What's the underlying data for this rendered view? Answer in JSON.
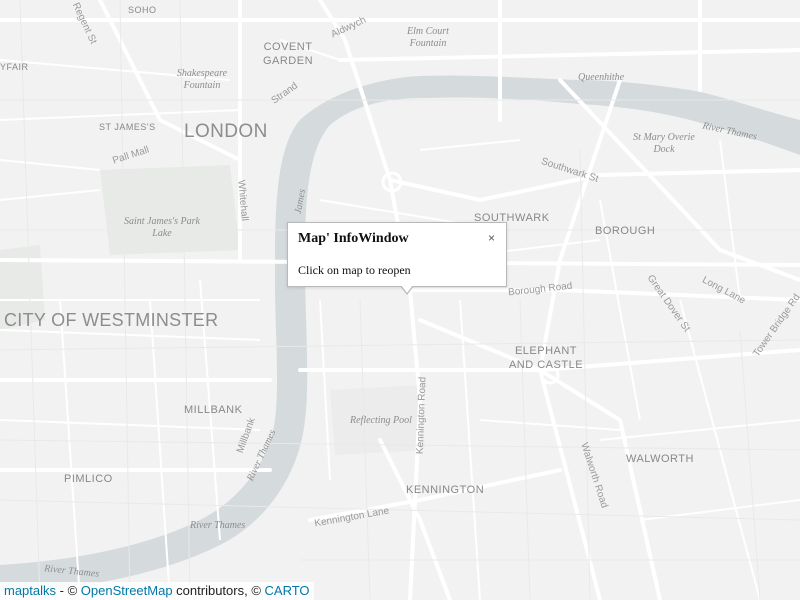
{
  "map": {
    "labels": {
      "soho": "SOHO",
      "covent_garden": "COVENT GARDEN",
      "elm_court": "Elm Court Fountain",
      "shakespeare": "Shakespeare Fountain",
      "queenhithe": "Queenhithe",
      "st_james": "ST JAMES'S",
      "london": "LONDON",
      "pall_mall": "Pall Mall",
      "whitehall": "Whitehall",
      "st_mary_overie": "St Mary Overie Dock",
      "river_thames_ne": "River Thames",
      "southwark_st": "Southwark St",
      "saint_james_park": "Saint James's Park Lake",
      "southwark": "SOUTHWARK",
      "borough": "BOROUGH",
      "borough_road": "Borough Road",
      "city_westminster": "CITY OF WESTMINSTER",
      "elephant_castle": "ELEPHANT AND CASTLE",
      "long_lane": "Long Lane",
      "great_dover": "Great Dover St",
      "tower_bridge": "Tower Bridge Rd",
      "millbank": "MILLBANK",
      "reflecting_pool": "Reflecting Pool",
      "kennington_road": "Kennington Road",
      "river_thames_mid": "River Thames",
      "millbank_road": "Millbank",
      "walworth_road": "Walworth Road",
      "walworth": "WALWORTH",
      "pimlico": "PIMLICO",
      "kennington": "KENNINGTON",
      "river_thames_sw": "River Thames",
      "kennington_lane": "Kennington Lane",
      "river_thames_bottom": "River Thames",
      "aldwych": "Aldwych",
      "strand": "Strand",
      "fair": "YFAIR",
      "street_left": "Regent St",
      "james_road": "James"
    }
  },
  "infowindow": {
    "title": "Map' InfoWindow",
    "close": "×",
    "content": "Click on map to reopen"
  },
  "attribution": {
    "maptalks": "maptalks",
    "sep": " - © ",
    "osm": "OpenStreetMap",
    "contributors": " contributors, © ",
    "carto": "CARTO"
  },
  "colors": {
    "land": "#f2f2f2",
    "water": "#d4dadc",
    "park": "#e6e8e6",
    "road": "#ffffff",
    "link": "#0078a8"
  }
}
